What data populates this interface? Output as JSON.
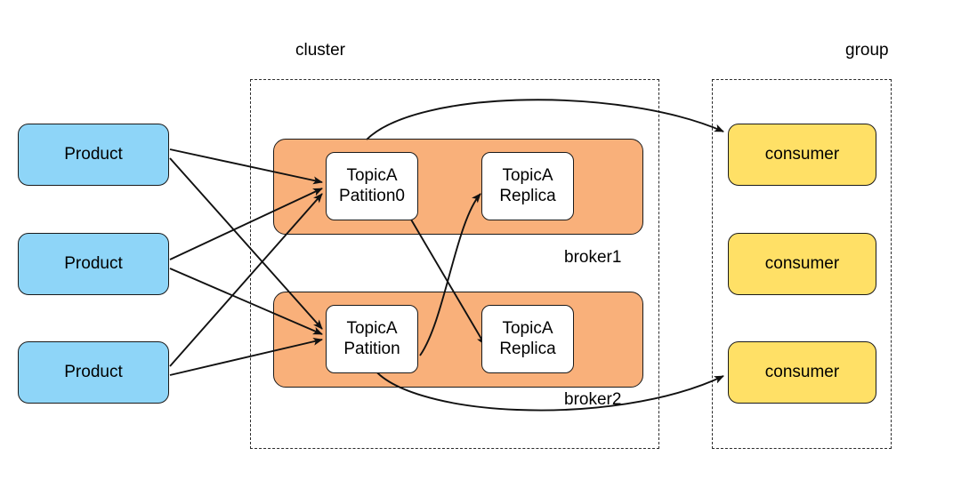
{
  "diagram": {
    "title": "kafka-producer-broker-consumer-diagram",
    "colors": {
      "producer_fill": "#8ED5F8",
      "broker_fill": "#F9B07A",
      "partition_fill": "#FFFFFF",
      "consumer_fill": "#FFE066",
      "stroke": "#1A1A1A",
      "dashed_stroke": "#2B2B2B",
      "background": "#FFFFFF"
    },
    "captions": {
      "cluster": "cluster",
      "group": "group",
      "broker1": "broker1",
      "broker2": "broker2"
    },
    "producers": [
      {
        "label": "Product"
      },
      {
        "label": "Product"
      },
      {
        "label": "Product"
      }
    ],
    "brokers": [
      {
        "name": "broker1",
        "nodes": [
          {
            "label": "TopicA\nPatition0"
          },
          {
            "label": "TopicA\nReplica"
          }
        ]
      },
      {
        "name": "broker2",
        "nodes": [
          {
            "label": "TopicA\nPatition"
          },
          {
            "label": "TopicA\nReplica"
          }
        ]
      }
    ],
    "consumers": [
      {
        "label": "consumer"
      },
      {
        "label": "consumer"
      },
      {
        "label": "consumer"
      }
    ]
  }
}
